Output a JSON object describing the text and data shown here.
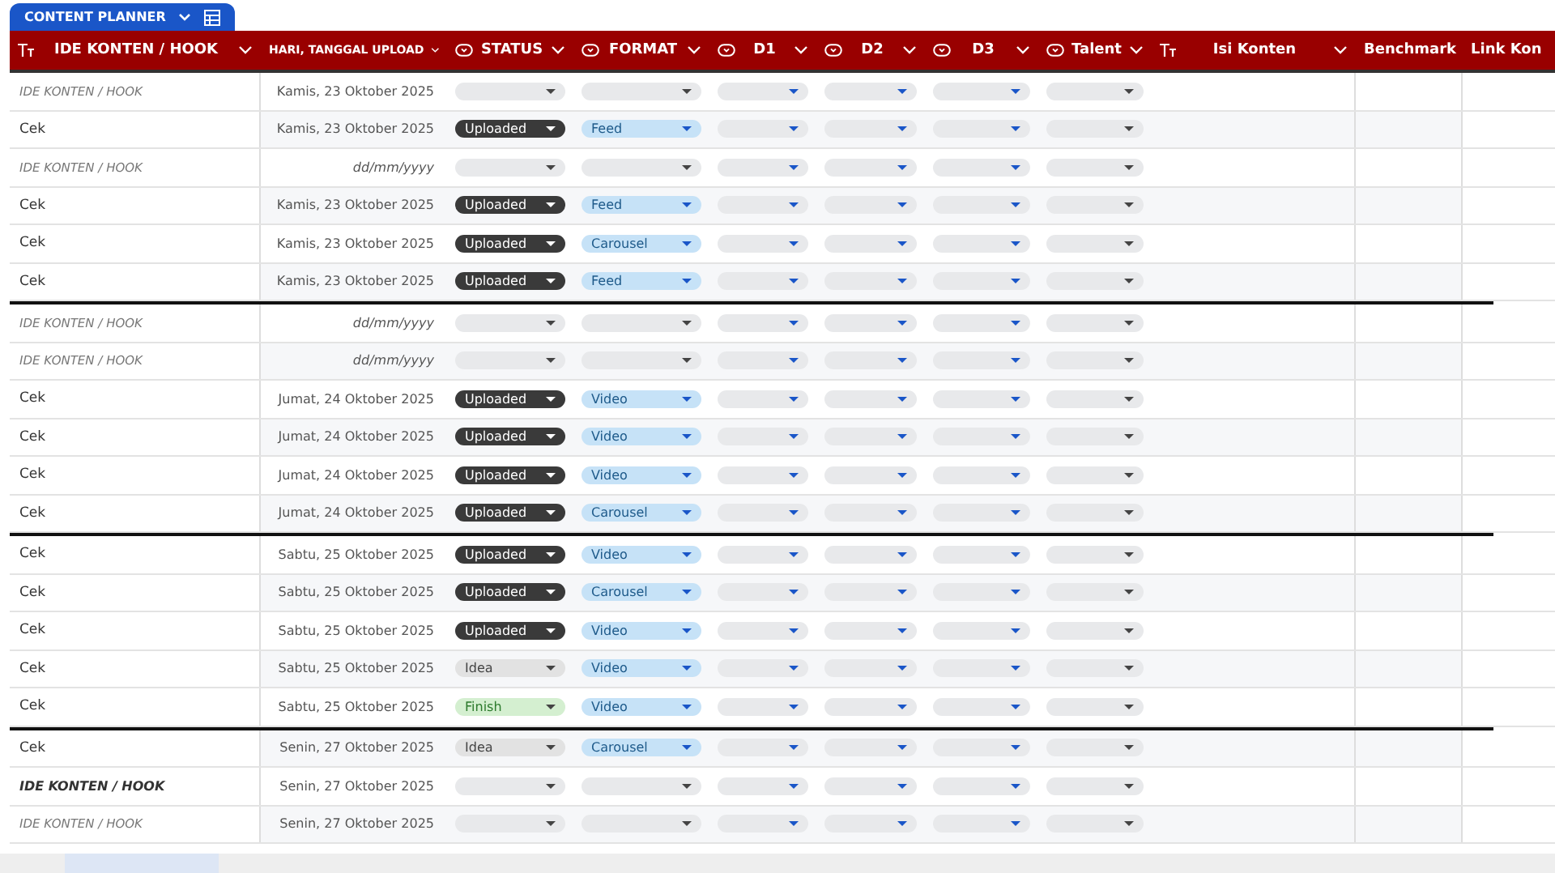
{
  "sheet_tab": {
    "label": "CONTENT PLANNER"
  },
  "columns": [
    {
      "label": "IDE KONTEN / HOOK"
    },
    {
      "label": "HARI, TANGGAL UPLOAD"
    },
    {
      "label": "STATUS"
    },
    {
      "label": "FORMAT"
    },
    {
      "label": "D1"
    },
    {
      "label": "D2"
    },
    {
      "label": "D3"
    },
    {
      "label": "Talent"
    },
    {
      "label": "Isi Konten"
    },
    {
      "label": "Benchmark"
    },
    {
      "label": "Link Kon"
    }
  ],
  "rows": [
    {
      "idea": {
        "text": "IDE KONTEN / HOOK",
        "kind": "hint"
      },
      "date": {
        "text": "Kamis, 23 Oktober 2025",
        "kind": "value"
      }
    },
    {
      "idea": {
        "text": "Cek",
        "kind": "value"
      },
      "date": {
        "text": "Kamis, 23 Oktober 2025",
        "kind": "value"
      },
      "status": {
        "label": "Uploaded",
        "kind": "uploaded"
      },
      "format": "Feed"
    },
    {
      "idea": {
        "text": "IDE KONTEN / HOOK",
        "kind": "hint"
      },
      "date": {
        "text": "dd/mm/yyyy",
        "kind": "hint"
      }
    },
    {
      "idea": {
        "text": "Cek",
        "kind": "value"
      },
      "date": {
        "text": "Kamis, 23 Oktober 2025",
        "kind": "value"
      },
      "status": {
        "label": "Uploaded",
        "kind": "uploaded"
      },
      "format": "Feed"
    },
    {
      "idea": {
        "text": "Cek",
        "kind": "value"
      },
      "date": {
        "text": "Kamis, 23 Oktober 2025",
        "kind": "value"
      },
      "status": {
        "label": "Uploaded",
        "kind": "uploaded"
      },
      "format": "Carousel"
    },
    {
      "idea": {
        "text": "Cek",
        "kind": "value"
      },
      "date": {
        "text": "Kamis, 23 Oktober 2025",
        "kind": "value"
      },
      "status": {
        "label": "Uploaded",
        "kind": "uploaded"
      },
      "format": "Feed",
      "group_end": true
    },
    {
      "idea": {
        "text": "IDE KONTEN / HOOK",
        "kind": "hint"
      },
      "date": {
        "text": "dd/mm/yyyy",
        "kind": "hint"
      }
    },
    {
      "idea": {
        "text": "IDE KONTEN / HOOK",
        "kind": "hint"
      },
      "date": {
        "text": "dd/mm/yyyy",
        "kind": "hint"
      }
    },
    {
      "idea": {
        "text": "Cek",
        "kind": "value"
      },
      "date": {
        "text": "Jumat, 24 Oktober 2025",
        "kind": "value"
      },
      "status": {
        "label": "Uploaded",
        "kind": "uploaded"
      },
      "format": "Video"
    },
    {
      "idea": {
        "text": "Cek",
        "kind": "value"
      },
      "date": {
        "text": "Jumat, 24 Oktober 2025",
        "kind": "value"
      },
      "status": {
        "label": "Uploaded",
        "kind": "uploaded"
      },
      "format": "Video"
    },
    {
      "idea": {
        "text": "Cek",
        "kind": "value"
      },
      "date": {
        "text": "Jumat, 24 Oktober 2025",
        "kind": "value"
      },
      "status": {
        "label": "Uploaded",
        "kind": "uploaded"
      },
      "format": "Video"
    },
    {
      "idea": {
        "text": "Cek",
        "kind": "value"
      },
      "date": {
        "text": "Jumat, 24 Oktober 2025",
        "kind": "value"
      },
      "status": {
        "label": "Uploaded",
        "kind": "uploaded"
      },
      "format": "Carousel",
      "group_end": true
    },
    {
      "idea": {
        "text": "Cek",
        "kind": "value"
      },
      "date": {
        "text": "Sabtu, 25 Oktober 2025",
        "kind": "value"
      },
      "status": {
        "label": "Uploaded",
        "kind": "uploaded"
      },
      "format": "Video"
    },
    {
      "idea": {
        "text": "Cek",
        "kind": "value"
      },
      "date": {
        "text": "Sabtu, 25 Oktober 2025",
        "kind": "value"
      },
      "status": {
        "label": "Uploaded",
        "kind": "uploaded"
      },
      "format": "Carousel"
    },
    {
      "idea": {
        "text": "Cek",
        "kind": "value"
      },
      "date": {
        "text": "Sabtu, 25 Oktober 2025",
        "kind": "value"
      },
      "status": {
        "label": "Uploaded",
        "kind": "uploaded"
      },
      "format": "Video"
    },
    {
      "idea": {
        "text": "Cek",
        "kind": "value"
      },
      "date": {
        "text": "Sabtu, 25 Oktober 2025",
        "kind": "value"
      },
      "status": {
        "label": "Idea",
        "kind": "idea"
      },
      "format": "Video"
    },
    {
      "idea": {
        "text": "Cek",
        "kind": "value"
      },
      "date": {
        "text": "Sabtu, 25 Oktober 2025",
        "kind": "value"
      },
      "status": {
        "label": "Finish",
        "kind": "finish"
      },
      "format": "Video",
      "group_end": true
    },
    {
      "idea": {
        "text": "Cek",
        "kind": "value"
      },
      "date": {
        "text": "Senin, 27 Oktober 2025",
        "kind": "value"
      },
      "status": {
        "label": "Idea",
        "kind": "idea"
      },
      "format": "Carousel"
    },
    {
      "idea": {
        "text": "IDE KONTEN / HOOK",
        "kind": "bold"
      },
      "date": {
        "text": "Senin, 27 Oktober 2025",
        "kind": "value"
      }
    },
    {
      "idea": {
        "text": "IDE KONTEN / HOOK",
        "kind": "hint"
      },
      "date": {
        "text": "Senin, 27 Oktober 2025",
        "kind": "value"
      }
    }
  ]
}
